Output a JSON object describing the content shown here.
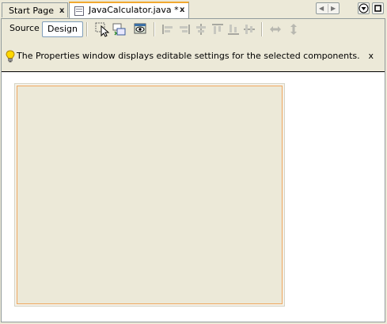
{
  "tabs": [
    {
      "label": "Start Page",
      "close": "x",
      "active": false
    },
    {
      "label": "JavaCalculator.java *",
      "close": "x",
      "active": true,
      "icon": "java-file-icon"
    }
  ],
  "tab_nav": [
    "scroll-left-icon",
    "scroll-right-icon",
    "document-list-icon",
    "maximize-icon"
  ],
  "toolbar": {
    "source_label": "Source",
    "design_label": "Design",
    "tools": [
      "selection-mode-icon",
      "connection-mode-icon",
      "preview-design-icon"
    ],
    "align_tools": [
      "align-left-icon",
      "align-right-icon",
      "center-horizontal-icon",
      "align-top-icon",
      "align-bottom-icon",
      "center-vertical-icon"
    ],
    "resize_tools": [
      "resize-horizontal-icon",
      "resize-vertical-icon"
    ]
  },
  "info": {
    "message": "The Properties window displays editable settings for the selected components.",
    "close_label": "x",
    "icon": "lightbulb-icon"
  },
  "colors": {
    "active_tab_accent": "#f0a830",
    "form_border": "#f0a860",
    "form_background": "#ece9d8"
  }
}
